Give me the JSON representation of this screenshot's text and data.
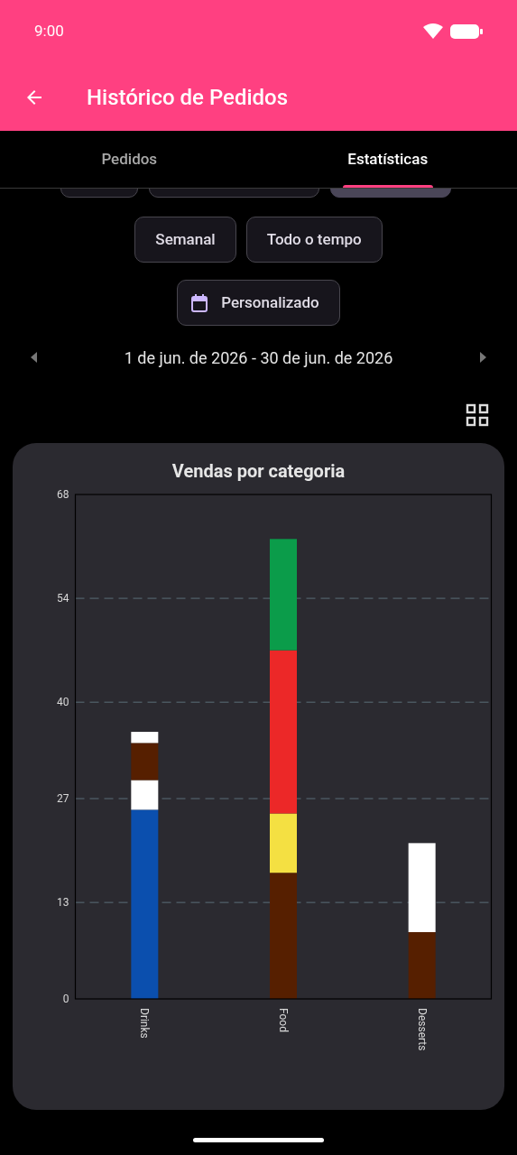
{
  "status_bar": {
    "time": "9:00"
  },
  "app_bar": {
    "title": "Histórico de Pedidos"
  },
  "tabs": [
    {
      "label": "Pedidos",
      "selected": false
    },
    {
      "label": "Estatísticas",
      "selected": true
    }
  ],
  "cut_chips": [
    {
      "selected": false
    },
    {
      "selected": false
    },
    {
      "selected": true
    }
  ],
  "period_chips": [
    {
      "label": "Semanal",
      "selected": false
    },
    {
      "label": "Todo o tempo",
      "selected": false
    }
  ],
  "custom_chip": {
    "label": "Personalizado",
    "selected": false
  },
  "date_range": "1 de jun. de 2026 - 30 de jun. de 2026",
  "chart_card": {
    "chart_data": {
      "type": "bar",
      "title": "Vendas por categoria",
      "grid": true,
      "stacked": true,
      "orientation": "vertical",
      "categories": [
        "Drinks",
        "Food",
        "Desserts"
      ],
      "ylim": [
        0,
        68
      ],
      "yticks": [
        0,
        13,
        27,
        40,
        54,
        68
      ],
      "series": [
        {
          "color": "#561f00",
          "values": [
            null,
            17,
            9
          ]
        },
        {
          "color": "#0b4fae",
          "values": [
            25.5,
            null,
            null
          ]
        },
        {
          "color": "#ffffff",
          "values": [
            4,
            null,
            12
          ]
        },
        {
          "color": "#f4e042",
          "values": [
            null,
            8,
            null
          ]
        },
        {
          "color": "#561f00",
          "values": [
            5,
            null,
            null
          ]
        },
        {
          "color": "#ec2828",
          "values": [
            null,
            22,
            null
          ]
        },
        {
          "color": "#ffffff",
          "values": [
            1.5,
            null,
            null
          ]
        },
        {
          "color": "#0b9c4a",
          "values": [
            null,
            15,
            null
          ]
        }
      ]
    }
  }
}
